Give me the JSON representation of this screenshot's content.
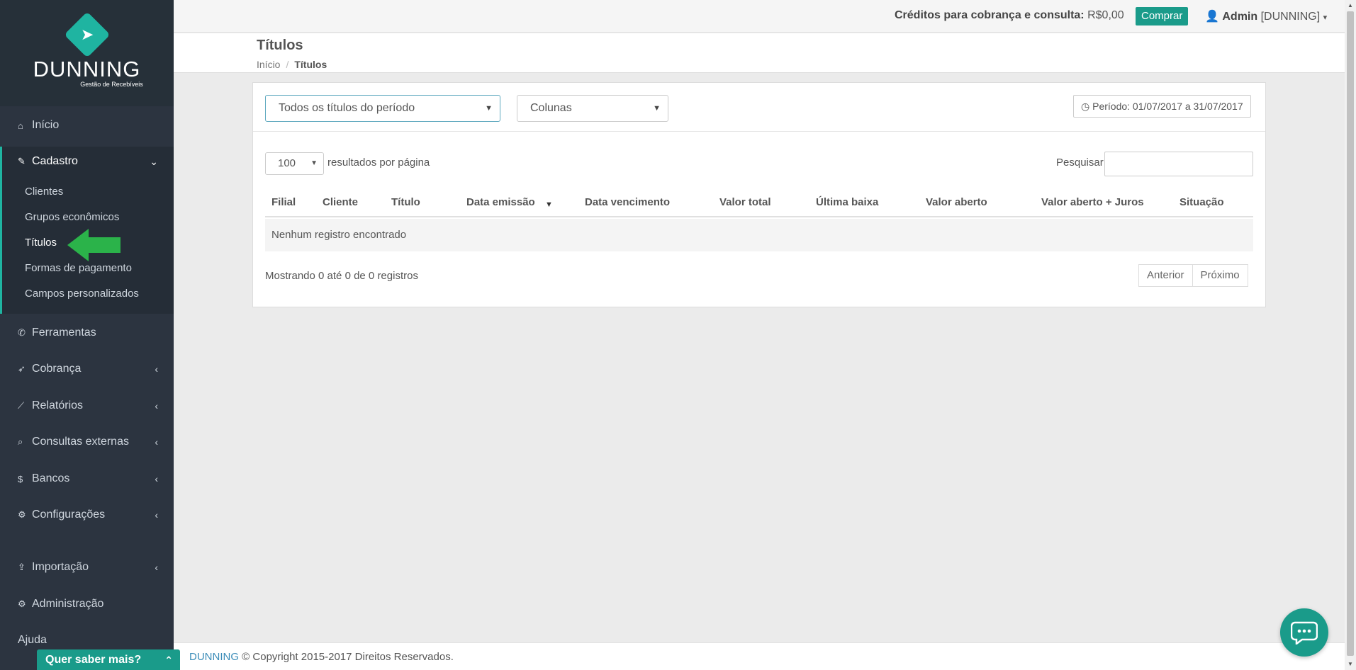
{
  "logo": {
    "text": "DUNNING",
    "subtitle": "Gestão de Recebíveis"
  },
  "sidebar": {
    "inicio": "Início",
    "cadastro": "Cadastro",
    "cadastro_sub": [
      "Clientes",
      "Grupos econômicos",
      "Títulos",
      "Formas de pagamento",
      "Campos personalizados"
    ],
    "ferramentas": "Ferramentas",
    "cobranca": "Cobrança",
    "relatorios": "Relatórios",
    "consultas": "Consultas externas",
    "bancos": "Bancos",
    "configuracoes": "Configurações",
    "importacao": "Importação",
    "administracao": "Administração",
    "ajuda": "Ajuda"
  },
  "topbar": {
    "credits_label": "Créditos para cobrança e consulta:",
    "credits_value": "R$0,00",
    "buy_label": "Comprar",
    "user_name": "Admin",
    "user_company": "[DUNNING]"
  },
  "page": {
    "title": "Títulos",
    "breadcrumb_home": "Início",
    "breadcrumb_current": "Títulos"
  },
  "filters": {
    "period_filter": "Todos os títulos do período",
    "columns": "Colunas",
    "period_button": "Período: 01/07/2017 a 31/07/2017"
  },
  "table": {
    "page_length": "100",
    "page_length_label": "resultados por página",
    "search_label": "Pesquisar",
    "columns": [
      "Filial",
      "Cliente",
      "Título",
      "Data emissão",
      "Data vencimento",
      "Valor total",
      "Última baixa",
      "Valor aberto",
      "Valor aberto + Juros",
      "Situação"
    ],
    "empty_message": "Nenhum registro encontrado",
    "info": "Mostrando 0 até 0 de 0 registros",
    "prev": "Anterior",
    "next": "Próximo"
  },
  "footer": {
    "brand": "DUNNING",
    "text": "© Copyright 2015-2017 Direitos Reservados."
  },
  "help_tab": "Quer saber mais?",
  "colors": {
    "accent": "#1a9b8a",
    "sidebar": "#2c3440"
  }
}
